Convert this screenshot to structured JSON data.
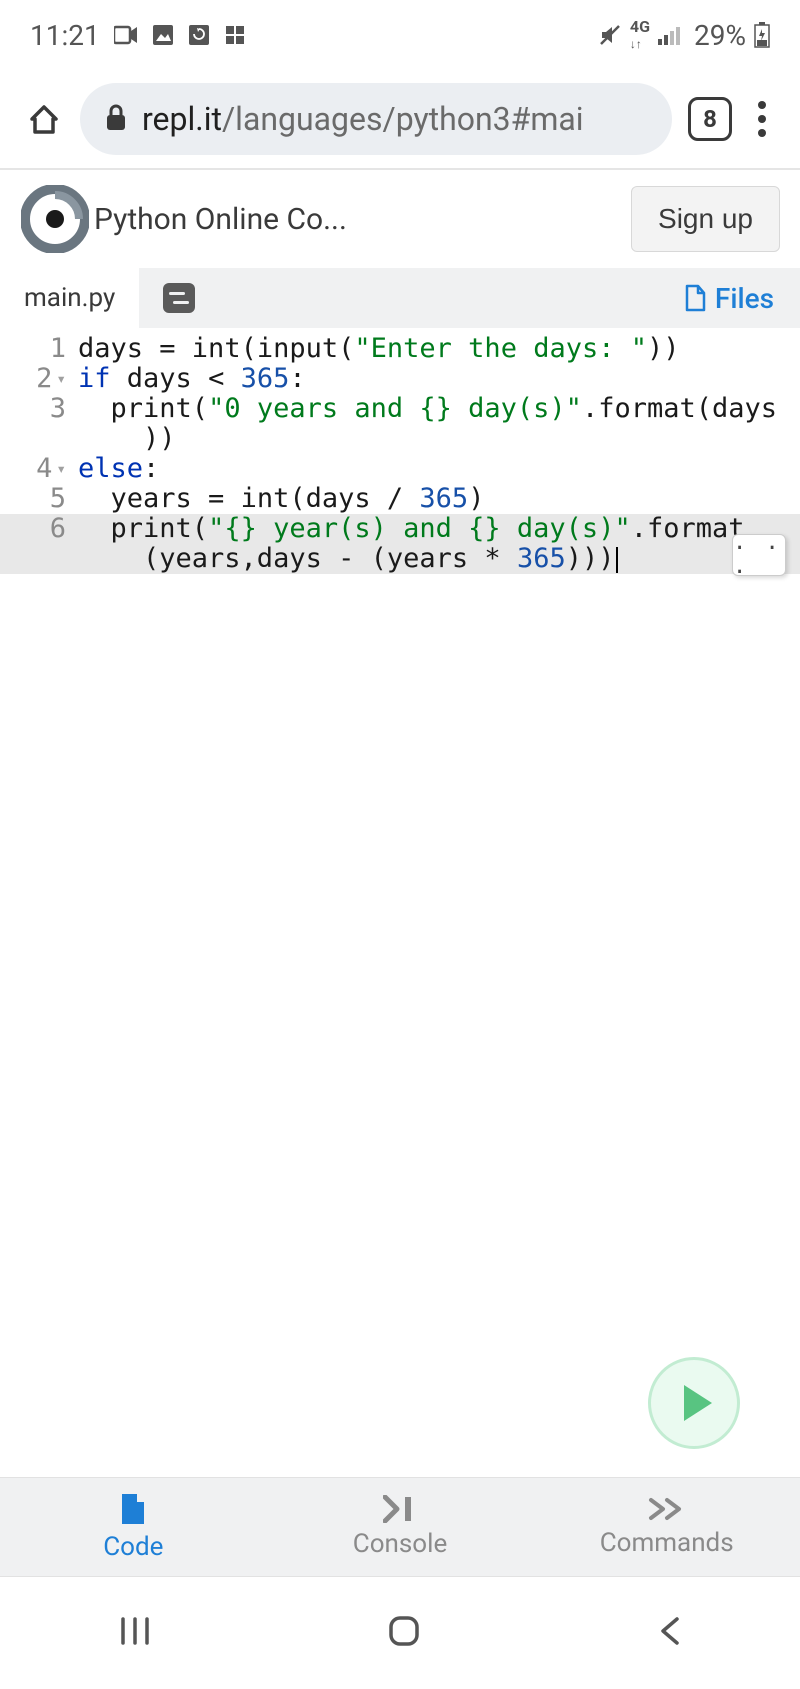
{
  "status": {
    "time": "11:21",
    "battery": "29%",
    "network_label": "4G"
  },
  "browser": {
    "url_host": "repl.it",
    "url_path": "/languages/python3#mai",
    "tab_count": "8"
  },
  "app": {
    "title": "Python Online Co...",
    "signup_label": "Sign up"
  },
  "tabs": {
    "file_name": "main.py",
    "files_label": "Files"
  },
  "code": {
    "line1_a": "days ",
    "line1_b": "=",
    "line1_c": " int",
    "line1_d": "(",
    "line1_e": "input",
    "line1_f": "(",
    "line1_g": "\"Enter the days: \"",
    "line1_h": "))",
    "line2_a": "if",
    "line2_b": " days ",
    "line2_c": "<",
    "line2_d": " ",
    "line2_e": "365",
    "line2_f": ":",
    "line3_a": "  print",
    "line3_b": "(",
    "line3_c": "\"0 years and {} day(s)\"",
    "line3_d": ".format(days",
    "line3_cont": "    ))",
    "line4_a": "else",
    "line4_b": ":",
    "line5_a": "  years ",
    "line5_b": "=",
    "line5_c": " int",
    "line5_d": "(days ",
    "line5_e": "/",
    "line5_f": " ",
    "line5_g": "365",
    "line5_h": ")",
    "line6_a": "  print",
    "line6_b": "(",
    "line6_c": "\"{} year(s) and {} day(s)\"",
    "line6_d": ".format",
    "line6_cont_a": "    (years,days ",
    "line6_cont_b": "-",
    "line6_cont_c": " (years ",
    "line6_cont_d": "*",
    "line6_cont_e": " ",
    "line6_cont_f": "365",
    "line6_cont_g": ")))"
  },
  "gutter": {
    "l1": "1",
    "l2": "2",
    "l3": "3",
    "l4": "4",
    "l5": "5",
    "l6": "6"
  },
  "expand": {
    "label": ". . ."
  },
  "bottom": {
    "code": "Code",
    "console": "Console",
    "commands": "Commands"
  }
}
